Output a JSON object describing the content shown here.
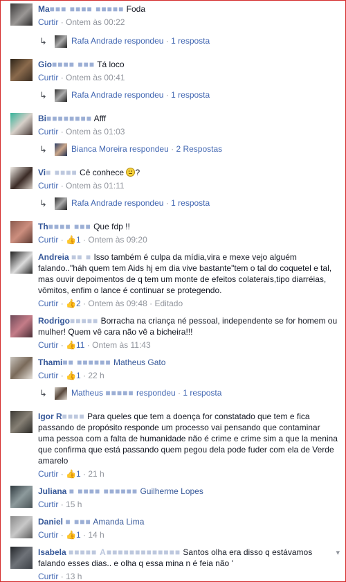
{
  "labels": {
    "reply": "Curtir",
    "replied_suffix": "respondeu",
    "dot": "·"
  },
  "comments": [
    {
      "name": "Ma",
      "blur": "■■■ ■■■■ ■■■■■",
      "text": "Foda",
      "time": "Ontem às 00:22",
      "reply": {
        "name": "Rafa Andrade",
        "count": "1 resposta"
      }
    },
    {
      "name": "Gio",
      "blur": "■■■■ ■■■",
      "text": "Tá loco",
      "time": "Ontem às 00:41",
      "reply": {
        "name": "Rafa Andrade",
        "count": "1 resposta"
      }
    },
    {
      "name": "Bi",
      "blur": "■■■■■■■■",
      "text": "Afff",
      "time": "Ontem às 01:03",
      "reply": {
        "name": "Bianca Moreira",
        "count": "2 Respostas"
      }
    },
    {
      "name": "Vi",
      "blur": "■ ■■■■",
      "text": "Cê conhece",
      "after_emoji": "?",
      "time": "Ontem às 01:11",
      "reply": {
        "name": "Rafa Andrade",
        "count": "1 resposta"
      }
    },
    {
      "name": "Th",
      "blur": "■■■■ ■■■",
      "text": "Que fdp !!",
      "likes": "1",
      "time": "Ontem às 09:20"
    },
    {
      "name": "Andreia",
      "blur": "■■ ■",
      "text": "Isso também é culpa da mídia,vira e mexe vejo alguém falando..\"háh quem tem Aids hj em dia vive bastante\"tem o tal do coquetel e tal, mas ouvir depoimentos de q tem um monte de efeitos colaterais,tipo diarréias, vômitos, enfim o lance é continuar se protegendo.",
      "likes": "2",
      "time": "Ontem às 09:48",
      "edited": "Editado"
    },
    {
      "name": "Rodrigo",
      "blur": "■■■■■",
      "text": "Borracha na criança né pessoal, independente se for homem ou mulher! Quem vê cara não vê a bicheira!!!",
      "likes": "11",
      "time": "Ontem às 11:43"
    },
    {
      "name": "Thami",
      "blur": "■■ ■■■■■■",
      "tag": "Matheus Gato",
      "likes": "1",
      "time": "22 h",
      "reply": {
        "name": "Matheus",
        "blur": "■■■■■",
        "count": "1 resposta"
      }
    },
    {
      "name": "Igor R",
      "blur": "■■■■",
      "text": "Para queles que tem a doença for constatado que tem e fica passando de propósito responde um processo vai pensando que contaminar uma pessoa com a falta de humanidade não é crime e crime sim a que la menina que confirma que está passando quem pegou dela pode fuder com ela de Verde amarelo",
      "likes": "1",
      "time": "21 h"
    },
    {
      "name": "Juliana",
      "blur": "■ ■■■■ ■■■■■■",
      "tag": "Guilherme Lopes",
      "time": "15 h"
    },
    {
      "name": "Daniel",
      "blur": "■ ■■■",
      "tag": "Amanda Lima",
      "likes": "1",
      "time": "14 h"
    },
    {
      "name": "Isabela",
      "blur": "■■■■■ A■■■■■■■■■■■■■",
      "text": "Santos olha era disso q estávamos falando esses dias.. e olha q essa mina n é feia não '",
      "time": "13 h"
    }
  ]
}
